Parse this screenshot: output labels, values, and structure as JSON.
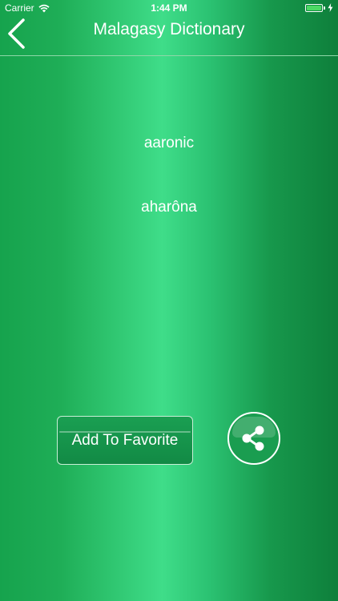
{
  "status_bar": {
    "carrier": "Carrier",
    "time": "1:44 PM",
    "wifi_icon": "wifi-icon",
    "battery_icon": "battery-icon",
    "charging_icon": "bolt-icon",
    "battery_level": 1.0
  },
  "nav": {
    "back_icon": "chevron-left-icon",
    "title": "Malagasy Dictionary"
  },
  "entry": {
    "word": "aaronic",
    "translation": "aharôna"
  },
  "actions": {
    "favorite_label": "Add To Favorite",
    "share_icon": "share-icon"
  },
  "colors": {
    "background_light": "#3fdd89",
    "background_dark": "#0e7f3b",
    "button_green": "#1a9f52",
    "text": "#ffffff",
    "battery_fill": "#4cd964"
  }
}
